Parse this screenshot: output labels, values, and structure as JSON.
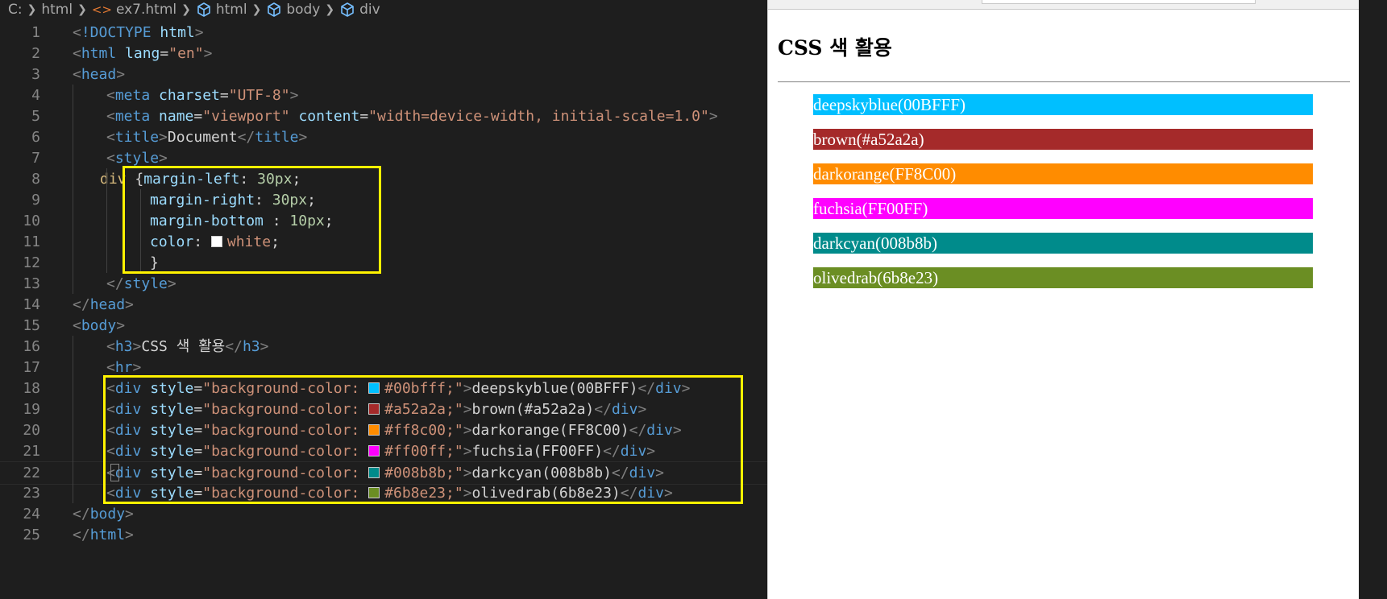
{
  "breadcrumb": {
    "items": [
      "C:",
      "html",
      "ex7.html",
      "html",
      "body",
      "div"
    ]
  },
  "code_lines": [
    "<!DOCTYPE html>",
    "<html lang=\"en\">",
    "<head>",
    "<meta charset=\"UTF-8\">",
    "<meta name=\"viewport\" content=\"width=device-width, initial-scale=1.0\">",
    "<title>Document</title>",
    "<style>",
    "div {margin-left: 30px;",
    "margin-right: 30px;",
    "margin-bottom : 10px;",
    "color: white;",
    "}",
    "</style>",
    "</head>",
    "<body>",
    "<h3>CSS 색 활용</h3>",
    "<hr>",
    "<div style=\"background-color: #00bfff;\">deepskyblue(00BFFF)</div>",
    "<div style=\"background-color: #a52a2a;\">brown(#a52a2a)</div>",
    "<div style=\"background-color: #ff8c00;\">darkorange(FF8C00)</div>",
    "<div style=\"background-color: #ff00ff;\">fuchsia(FF00FF)</div>",
    "<div style=\"background-color: #008b8b;\">darkcyan(008b8b)</div>",
    "<div style=\"background-color: #6b8e23;\">olivedrab(6b8e23)</div>",
    "</body>",
    "</html>"
  ],
  "swatch_colors": {
    "white": "#ffffff",
    "deepskyblue": "#00bfff",
    "brown": "#a52a2a",
    "darkorange": "#ff8c00",
    "fuchsia": "#ff00ff",
    "darkcyan": "#008b8b",
    "olivedrab": "#6b8e23"
  },
  "highlight_color": "#fff200",
  "preview": {
    "title": "CSS 색 활용",
    "divs": [
      {
        "label": "deepskyblue(00BFFF)",
        "color": "#00bfff"
      },
      {
        "label": "brown(#a52a2a)",
        "color": "#a52a2a"
      },
      {
        "label": "darkorange(FF8C00)",
        "color": "#ff8c00"
      },
      {
        "label": "fuchsia(FF00FF)",
        "color": "#ff00ff"
      },
      {
        "label": "darkcyan(008b8b)",
        "color": "#008b8b"
      },
      {
        "label": "olivedrab(6b8e23)",
        "color": "#6b8e23"
      }
    ]
  }
}
